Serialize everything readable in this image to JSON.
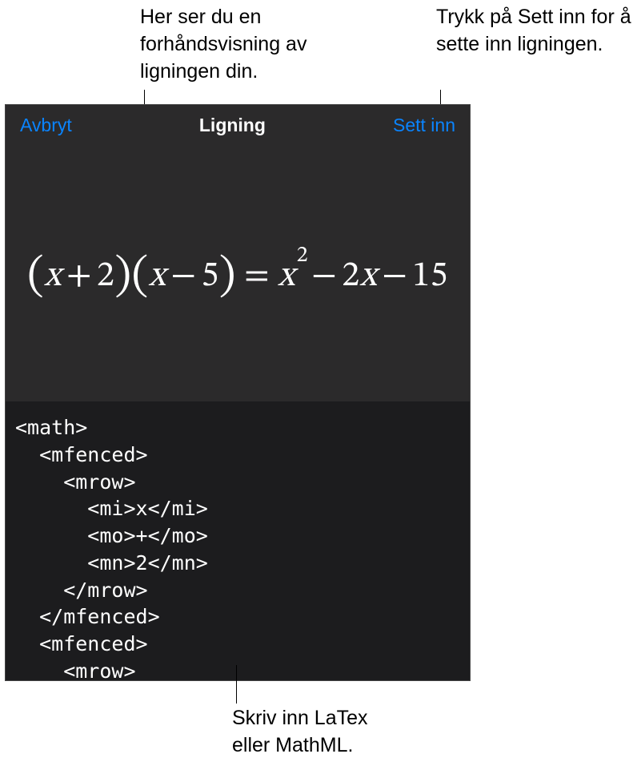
{
  "callouts": {
    "preview": "Her ser du en\nforhåndsvisning av\nligningen din.",
    "insert": "Trykk på Sett inn\nfor å sette inn\nligningen.",
    "code": "Skriv inn LaTex\neller MathML."
  },
  "nav": {
    "cancel": "Avbryt",
    "title": "Ligning",
    "insert": "Sett inn"
  },
  "equation_preview": {
    "lhs_a_var": "x",
    "lhs_a_op": "+",
    "lhs_a_num": "2",
    "lhs_b_var": "x",
    "lhs_b_op": "−",
    "lhs_b_num": "5",
    "eq": "=",
    "rhs_term1_var": "x",
    "rhs_term1_exp": "2",
    "rhs_op1": "−",
    "rhs_term2_coef": "2",
    "rhs_term2_var": "x",
    "rhs_op2": "−",
    "rhs_term3": "15"
  },
  "code": "<math>\n  <mfenced>\n    <mrow>\n      <mi>x</mi>\n      <mo>+</mo>\n      <mn>2</mn>\n    </mrow>\n  </mfenced>\n  <mfenced>\n    <mrow>"
}
